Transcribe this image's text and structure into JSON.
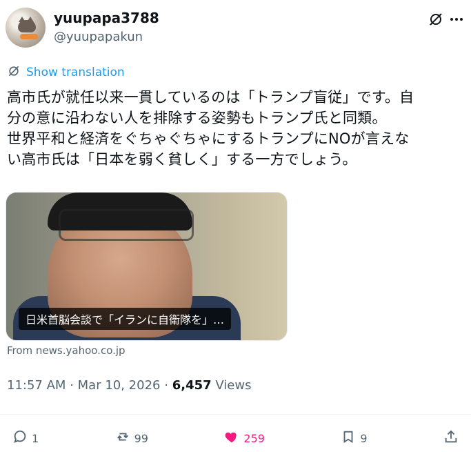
{
  "author": {
    "display_name": "yuupapa3788",
    "handle": "@yuupapakun"
  },
  "header_icons": {
    "grok": "grok-icon",
    "more": "more-icon"
  },
  "translate": {
    "label": "Show translation",
    "icon": "translate-icon"
  },
  "tweet": {
    "text": "高市氏が就任以来一貫しているのは「トランプ盲従」です。自\n分の意に沿わない人を排除する姿勢もトランプ氏と同類。\n世界平和と経済をぐちゃぐちゃにするトランプにNOが言えな\nい高市氏は「日本を弱く貧しく」する一方でしょう。"
  },
  "card": {
    "caption": "日米首脳会談で「イランに自衛隊を」…",
    "source": "From news.yahoo.co.jp"
  },
  "meta": {
    "time": "11:57 AM",
    "sep": "·",
    "date": "Mar 10, 2026",
    "views_count": "6,457",
    "views_label": "Views"
  },
  "actions": {
    "reply": {
      "icon": "reply-icon",
      "count": "1"
    },
    "retweet": {
      "icon": "retweet-icon",
      "count": "99"
    },
    "like": {
      "icon": "heart-icon",
      "count": "259",
      "color": "#f91880"
    },
    "bookmark": {
      "icon": "bookmark-icon",
      "count": "9"
    },
    "share": {
      "icon": "share-icon"
    }
  }
}
